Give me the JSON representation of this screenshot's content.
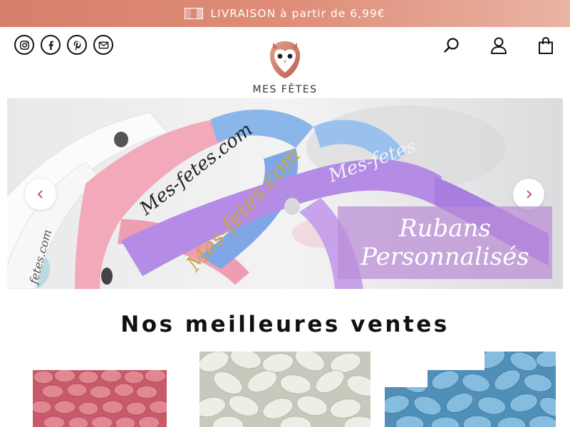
{
  "announcement": {
    "flag_icon": "flag-icon",
    "text": "LIVRAISON à partir de 6,99€"
  },
  "header": {
    "socials": [
      {
        "name": "instagram-icon",
        "label": "Instagram"
      },
      {
        "name": "facebook-icon",
        "label": "Facebook"
      },
      {
        "name": "pinterest-icon",
        "label": "Pinterest"
      },
      {
        "name": "mail-icon",
        "label": "Email"
      }
    ],
    "brand": "MES FÊTES",
    "logo_icon": "owl-icon",
    "actions": [
      "search-icon",
      "account-icon",
      "cart-icon"
    ]
  },
  "hero": {
    "caption_line1": "Rubans",
    "caption_line2": "Personnalisés",
    "ribbon_text_1": "Mes-fetes.com",
    "ribbon_text_2": "Mes-fetes.com",
    "ribbon_text_3": "Mes-fetes",
    "ribbon_text_4": "fetes.com",
    "prev_icon": "chevron-left-icon",
    "next_icon": "chevron-right-icon"
  },
  "bestsellers": {
    "title": "Nos meilleures ventes",
    "products": [
      {
        "color": "#d9727f",
        "kind": "dragées roses"
      },
      {
        "color": "#ecebe2",
        "kind": "dragées blanches"
      },
      {
        "color": "#7fb6d6",
        "kind": "dragées bleues"
      }
    ]
  },
  "colors": {
    "accent": "#d77f6a",
    "caption_bg": "#ba8cd6",
    "arrow": "#c05a7e"
  }
}
